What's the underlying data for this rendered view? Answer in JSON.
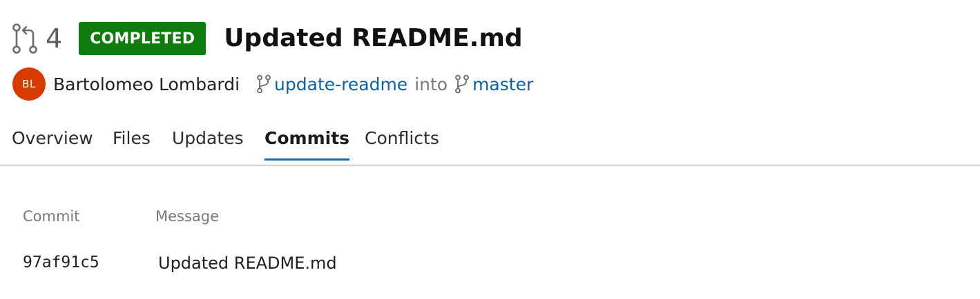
{
  "pull_request": {
    "number": "4",
    "status": "COMPLETED",
    "title": "Updated README.md"
  },
  "author": {
    "initials": "BL",
    "name": "Bartolomeo Lombardi"
  },
  "branches": {
    "source": "update-readme",
    "connector": "into",
    "target": "master"
  },
  "tabs": [
    {
      "label": "Overview"
    },
    {
      "label": "Files"
    },
    {
      "label": "Updates"
    },
    {
      "label": "Commits"
    },
    {
      "label": "Conflicts"
    }
  ],
  "commits_table": {
    "columns": [
      "Commit",
      "Message"
    ],
    "rows": [
      {
        "commit": "97af91c5",
        "message": "Updated README.md"
      }
    ]
  },
  "icons": {
    "pull_request": "pull-request-icon",
    "branch": "branch-icon"
  },
  "colors": {
    "status_completed": "#107c10",
    "avatar": "#d83b01",
    "link": "#0f5fa3",
    "active_tab_underline": "#0f6cbd"
  }
}
